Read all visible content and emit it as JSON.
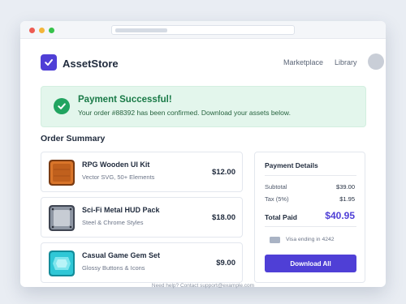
{
  "brand": {
    "name": "AssetStore",
    "accent": "#4f3fd6",
    "success": "#21a460"
  },
  "nav": {
    "marketplace": "Marketplace",
    "library": "Library"
  },
  "success": {
    "title": "Payment Successful!",
    "message": "Your order #88392 has been confirmed. Download your assets below."
  },
  "order_summary": {
    "title": "Order Summary",
    "items": [
      {
        "name": "RPG Wooden UI Kit",
        "subtitle": "Vector SVG, 50+ Elements",
        "price": "$12.00",
        "icon": "wooden-tile-icon"
      },
      {
        "name": "Sci-Fi Metal HUD Pack",
        "subtitle": "Steel & Chrome Styles",
        "price": "$18.00",
        "icon": "metal-tile-icon"
      },
      {
        "name": "Casual Game Gem Set",
        "subtitle": "Glossy Buttons & Icons",
        "price": "$9.00",
        "icon": "gem-tile-icon"
      }
    ]
  },
  "payment": {
    "title": "Payment Details",
    "subtotal_label": "Subtotal",
    "subtotal_value": "$39.00",
    "tax_label": "Tax (5%)",
    "tax_value": "$1.95",
    "total_label": "Total Paid",
    "total_value": "$40.95",
    "card_text": "Visa ending in 4242",
    "download_label": "Download All"
  },
  "footer": {
    "help_text": "Need help? Contact support@example.com"
  }
}
